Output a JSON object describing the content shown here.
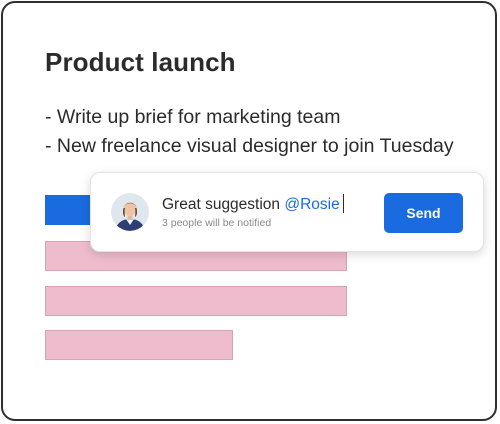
{
  "document": {
    "title": "Product launch",
    "bullets": [
      "- Write up brief for marketing team",
      "- New freelance visual designer to join Tuesday"
    ]
  },
  "comment": {
    "text": "Great suggestion ",
    "mention": "@Rosie",
    "notify": "3 people will be notified",
    "send_label": "Send"
  },
  "colors": {
    "accent": "#1a6be0",
    "placeholder_bar": "#efbcce",
    "text": "#2b2b2b",
    "muted": "#8a8a8a"
  }
}
